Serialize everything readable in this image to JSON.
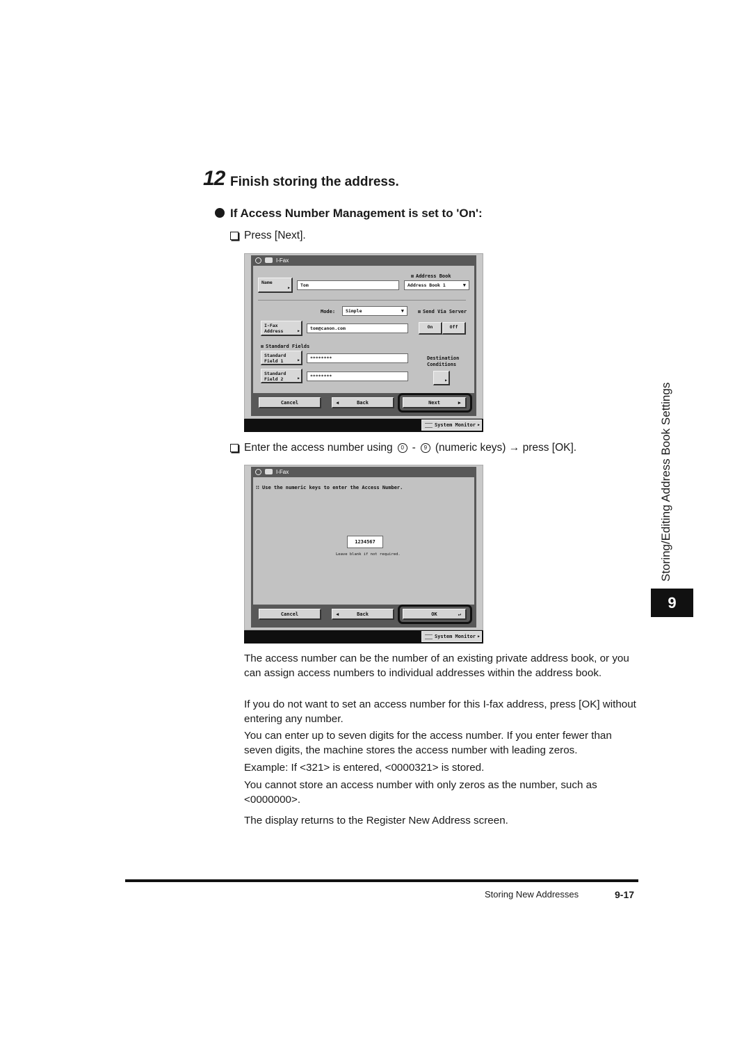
{
  "step": {
    "number": "12",
    "title": "Finish storing the address."
  },
  "condition": {
    "title": "If Access Number Management is set to 'On':"
  },
  "instructions": {
    "press_next": "Press [Next].",
    "enter_prefix": "Enter the access number using",
    "key_from": "0",
    "dash": "-",
    "key_to": "9",
    "enter_suffix": "(numeric keys) → press [OK]."
  },
  "screen1": {
    "title": "I-Fax",
    "name_button": "Name",
    "name_value": "Tom",
    "address_book_label": "Address Book",
    "address_book_value": "Address Book 1",
    "mode_label": "Mode:",
    "mode_value": "Simple",
    "send_via_server_label": "Send Via Server",
    "on_label": "On",
    "off_label": "Off",
    "ifax_button_line1": "I-Fax",
    "ifax_button_line2": "Address",
    "ifax_value": "tom@canon.com",
    "standard_fields_label": "Standard Fields",
    "sf1_line1": "Standard",
    "sf1_line2": "Field 1",
    "sf1_value": "********",
    "sf2_line1": "Standard",
    "sf2_line2": "Field 2",
    "sf2_value": "********",
    "dest_cond_line1": "Destination",
    "dest_cond_line2": "Conditions",
    "cancel": "Cancel",
    "back": "Back",
    "next": "Next",
    "system_monitor": "System Monitor"
  },
  "screen2": {
    "title": "I-Fax",
    "prompt": "Use the numeric keys to enter the Access Number.",
    "access_number": "1234567",
    "hint": "Leave blank if not required.",
    "cancel": "Cancel",
    "back": "Back",
    "ok": "OK",
    "system_monitor": "System Monitor"
  },
  "paragraphs": [
    "The access number can be the number of an existing private address book, or you can assign access numbers to individual addresses within the address book.",
    "If you do not want to set an access number for this I-fax address, press [OK] without entering any number.",
    "You can enter up to seven digits for the access number. If you enter fewer than seven digits, the machine stores the access number with leading zeros.",
    "Example: If <321> is entered, <0000321> is stored.",
    "You cannot store an access number with only zeros as the number, such as <0000000>.",
    "The display returns to the Register New Address screen."
  ],
  "side_tab": {
    "text": "Storing/Editing Address Book Settings",
    "chapter": "9"
  },
  "footer": {
    "section": "Storing New Addresses",
    "page": "9-17"
  }
}
